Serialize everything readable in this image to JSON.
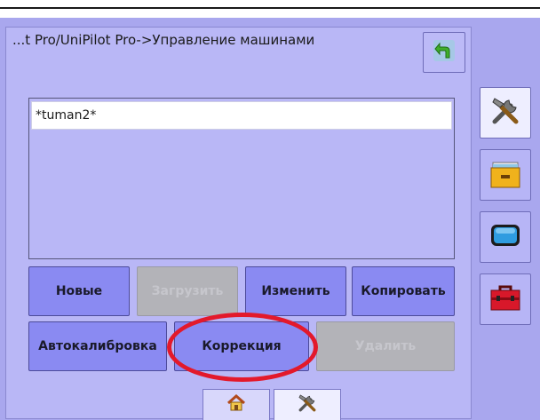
{
  "header": {
    "breadcrumb": "...t Pro/UniPilot Pro->Управление машинами"
  },
  "machine_list": {
    "items": [
      "*tuman2*"
    ],
    "selected_index": 0
  },
  "buttons": {
    "new": "Новые",
    "load": "Загрузить",
    "edit": "Изменить",
    "copy": "Копировать",
    "autocalibration": "Автокалибровка",
    "correction": "Коррекция",
    "delete": "Удалить"
  },
  "side_icons": [
    "tools-icon",
    "file-cabinet-icon",
    "display-icon",
    "toolbox-icon"
  ],
  "bottom_tabs": [
    "home-icon",
    "tools-icon"
  ],
  "colors": {
    "background": "#a9a7ee",
    "panel": "#b9b7f6",
    "button": "#8a8af2",
    "button_disabled": "#b3b3b8",
    "highlight": "#e3192b"
  }
}
